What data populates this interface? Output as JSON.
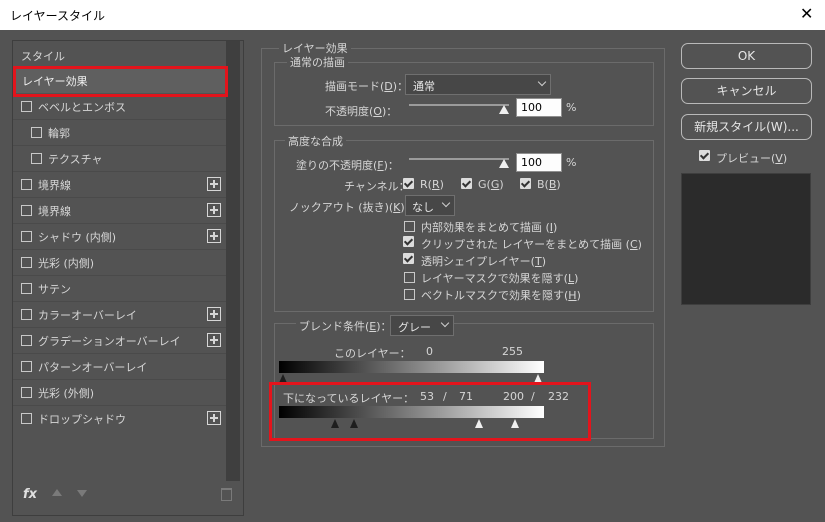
{
  "window": {
    "title": "レイヤースタイル",
    "close": "✕"
  },
  "sidebar": {
    "header": "スタイル",
    "items": [
      {
        "label": "レイヤー効果",
        "checkbox": false,
        "plus": false,
        "selected": true
      },
      {
        "label": "ベベルとエンボス",
        "checkbox": true,
        "plus": false
      },
      {
        "label": "輪郭",
        "checkbox": true,
        "plus": false,
        "indent": true
      },
      {
        "label": "テクスチャ",
        "checkbox": true,
        "plus": false,
        "indent": true
      },
      {
        "label": "境界線",
        "checkbox": true,
        "plus": true
      },
      {
        "label": "境界線",
        "checkbox": true,
        "plus": true
      },
      {
        "label": "シャドウ (内側)",
        "checkbox": true,
        "plus": true
      },
      {
        "label": "光彩 (内側)",
        "checkbox": true,
        "plus": false
      },
      {
        "label": "サテン",
        "checkbox": true,
        "plus": false
      },
      {
        "label": "カラーオーバーレイ",
        "checkbox": true,
        "plus": true
      },
      {
        "label": "グラデーションオーバーレイ",
        "checkbox": true,
        "plus": true
      },
      {
        "label": "パターンオーバーレイ",
        "checkbox": true,
        "plus": false
      },
      {
        "label": "光彩 (外側)",
        "checkbox": true,
        "plus": false
      },
      {
        "label": "ドロップシャドウ",
        "checkbox": true,
        "plus": true
      }
    ],
    "footer": {
      "fx": "fx"
    }
  },
  "layer_effects": {
    "title": "レイヤー効果",
    "general": {
      "title": "通常の描画",
      "blend_mode_label": "描画モード(",
      "blend_mode_key": "D",
      "blend_mode_value": "通常",
      "opacity_label": "不透明度(",
      "opacity_key": "O",
      "opacity_value": "100",
      "opacity_unit": "%"
    },
    "advanced": {
      "title": "高度な合成",
      "fill_opacity_label": "塗りの不透明度(",
      "fill_opacity_key": "F",
      "fill_opacity_value": "100",
      "fill_opacity_unit": "%",
      "channels_label": "チャンネル：",
      "channels": [
        {
          "name": "R(",
          "key": "R",
          "checked": true
        },
        {
          "name": "G(",
          "key": "G",
          "checked": true
        },
        {
          "name": "B(",
          "key": "B",
          "checked": true
        }
      ],
      "knockout_label": "ノックアウト (抜き)(",
      "knockout_key": "K",
      "knockout_value": "なし",
      "options": [
        {
          "label": "内部効果をまとめて描画 (",
          "key": "I",
          "checked": false
        },
        {
          "label": "クリップされた レイヤーをまとめて描画 (",
          "key": "C",
          "checked": true
        },
        {
          "label": "透明シェイプレイヤー(",
          "key": "T",
          "checked": true
        },
        {
          "label": "レイヤーマスクで効果を隠す(",
          "key": "L",
          "checked": false
        },
        {
          "label": "ベクトルマスクで効果を隠す(",
          "key": "H",
          "checked": false
        }
      ]
    },
    "blend_if": {
      "label": "ブレンド条件(",
      "key": "E",
      "value": "グレー",
      "this_layer_label": "このレイヤー：",
      "this_layer_low": "0",
      "this_layer_high": "255",
      "underlying_label": "下になっているレイヤー：",
      "underlying_low_a": "53",
      "underlying_low_b": "71",
      "underlying_high_a": "200",
      "underlying_high_b": "232",
      "slash": "/"
    }
  },
  "buttons": {
    "ok": "OK",
    "cancel": "キャンセル",
    "new_style": "新規スタイル(W)...",
    "preview_label": "プレビュー(",
    "preview_key": "V",
    "preview_checked": true
  },
  "colors": {
    "highlight": "#e3141c",
    "background": "#535353"
  }
}
